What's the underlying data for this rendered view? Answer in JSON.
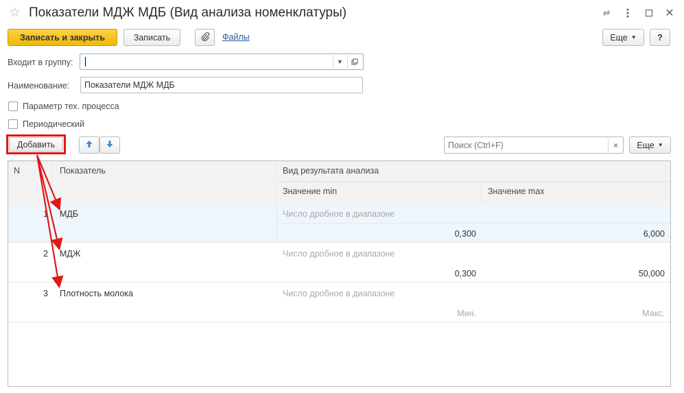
{
  "window": {
    "title": "Показатели МДЖ МДБ (Вид анализа номенклатуры)"
  },
  "toolbar": {
    "save_close": "Записать и закрыть",
    "save": "Записать",
    "files": "Файлы",
    "more": "Еще",
    "help": "?"
  },
  "form": {
    "group_label": "Входит в группу:",
    "group_value": "",
    "name_label": "Наименование:",
    "name_value": "Показатели МДЖ МДБ",
    "param_label": "Параметр тех. процесса",
    "periodic_label": "Периодический"
  },
  "table_toolbar": {
    "add": "Добавить",
    "search_placeholder": "Поиск (Ctrl+F)",
    "more": "Еще"
  },
  "table": {
    "columns": {
      "n": "N",
      "indicator": "Показатель",
      "result_type": "Вид результата анализа",
      "min": "Значение min",
      "max": "Значение max"
    },
    "rows": [
      {
        "n": "1",
        "indicator": "МДБ",
        "result_type": "Число дробное в диапазоне",
        "min": "0,300",
        "max": "6,000"
      },
      {
        "n": "2",
        "indicator": "МДЖ",
        "result_type": "Число дробное в диапазоне",
        "min": "0,300",
        "max": "50,000"
      },
      {
        "n": "3",
        "indicator": "Плотность молока",
        "result_type": "Число дробное в диапазоне",
        "min": "Мин.",
        "max": "Макс."
      }
    ]
  },
  "colors": {
    "accent": "#f2b700",
    "highlight": "#e11717",
    "selected_row": "#eef5fb"
  }
}
